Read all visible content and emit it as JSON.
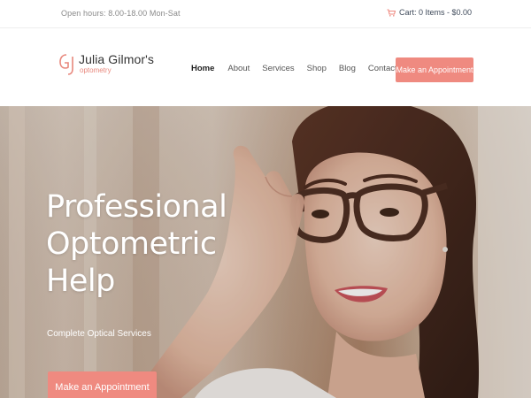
{
  "topbar": {
    "hours": "Open hours: 8.00-18.00 Mon-Sat",
    "cart_icon": "cart-icon",
    "cart_text": "Cart: 0 Items - $0.00"
  },
  "logo": {
    "mark": "GJ",
    "name": "Julia Gilmor's",
    "sub": "optometry"
  },
  "nav": {
    "items": [
      {
        "label": "Home",
        "active": true
      },
      {
        "label": "About",
        "active": false
      },
      {
        "label": "Services",
        "active": false
      },
      {
        "label": "Shop",
        "active": false
      },
      {
        "label": "Blog",
        "active": false
      },
      {
        "label": "Contacts",
        "active": false
      }
    ],
    "cta": "Make an Appointment"
  },
  "hero": {
    "title_lines": [
      "Professional",
      "Optometric",
      "Help"
    ],
    "subtitle": "Complete Optical Services",
    "cta": "Make an Appointment"
  },
  "colors": {
    "accent": "#ef8a80",
    "text_dark": "#333333",
    "muted": "#8a8a8a"
  }
}
